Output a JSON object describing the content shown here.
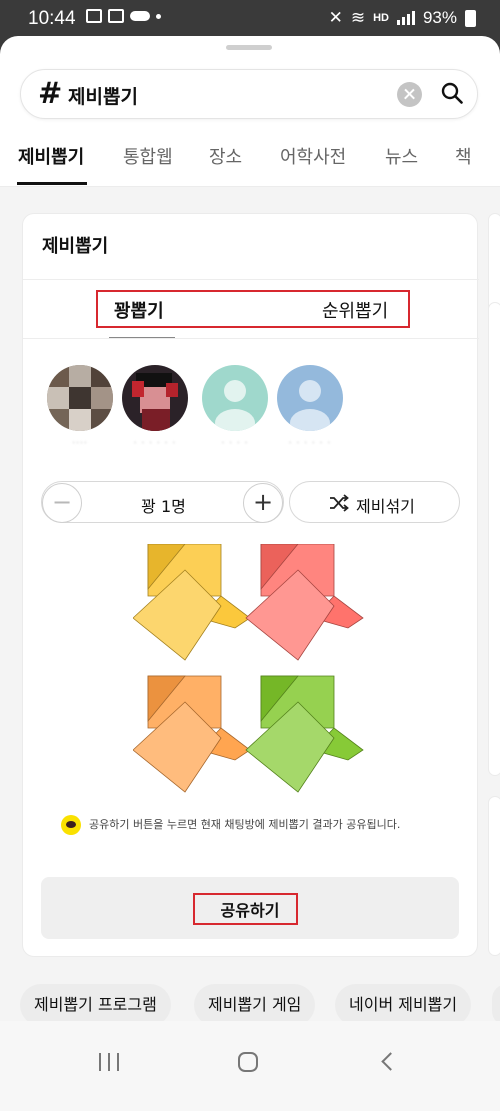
{
  "status_bar": {
    "time": "10:44",
    "battery": "93%",
    "network": "HD"
  },
  "search": {
    "hash_symbol": "#",
    "query": "제비뽑기"
  },
  "category_tabs": [
    "제비뽑기",
    "통합웹",
    "장소",
    "어학사전",
    "뉴스",
    "책"
  ],
  "card": {
    "title": "제비뽑기",
    "subtabs": [
      "꽝뽑기",
      "순위뽑기"
    ],
    "participants": [
      {
        "name": "...."
      },
      {
        "name": ". . . . . ."
      },
      {
        "name": ". . . ."
      },
      {
        "name": ". . . . . ."
      }
    ],
    "stepper": {
      "minus": "−",
      "plus": "+",
      "count_label": "꽝 1명"
    },
    "shuffle_label": "제비섞기",
    "envelope_colors": [
      "#fbc530",
      "#ff6a63",
      "#ff9f45",
      "#7fc72a"
    ],
    "notice": "공유하기 버튼을 누르면 현재 채팅방에 제비뽑기 결과가 공유됩니다.",
    "share_label": "공유하기"
  },
  "related_chips": [
    "제비뽑기 프로그램",
    "제비뽑기 게임",
    "네이버 제비뽑기"
  ]
}
